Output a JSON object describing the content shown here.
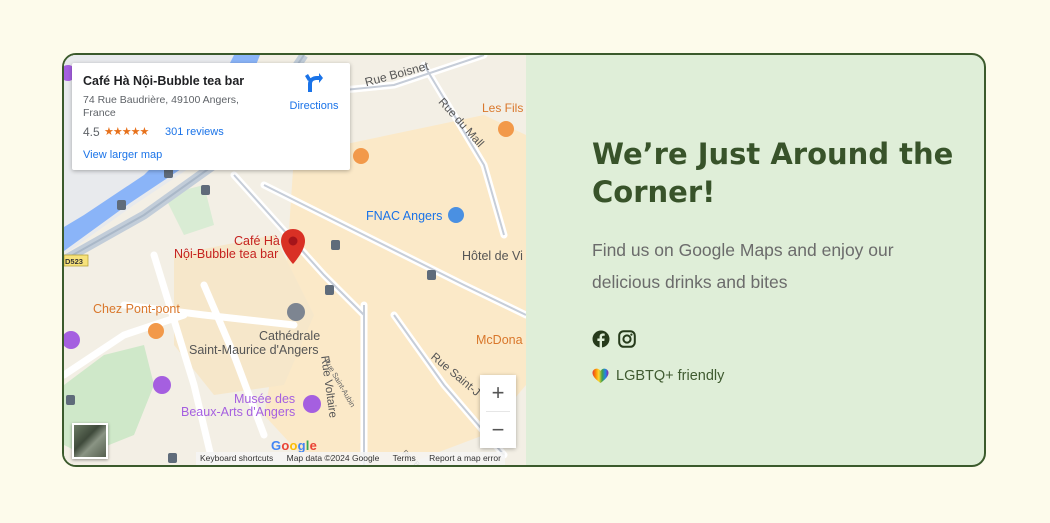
{
  "map": {
    "place_name": "Café Hà Nội-Bubble tea bar",
    "address": "74 Rue Baudrière, 49100 Angers, France",
    "rating": "4.5",
    "stars": "★★★★★",
    "reviews": "301 reviews",
    "view_larger_map": "View larger map",
    "directions_label": "Directions",
    "labels": {
      "rue_boisnet": "Rue Boisnet",
      "rue_du_mall": "Rue du Mall",
      "les_fils": "Les Fils",
      "fnac": "FNAC Angers",
      "hotel": "Hôtel de Vi",
      "cafe_line1": "Café Hà",
      "cafe_line2": "Nội-Bubble tea bar",
      "chez_pont": "Chez Pont-pont",
      "cathedral_line1": "Cathédrale",
      "cathedral_line2": "Saint-Maurice d'Angers",
      "mcdona": "McDona",
      "rue_voltaire": "Rue Voltaire",
      "rue_saint_aubin": "Rue Saint-Aubin",
      "rue_saint": "Rue Saint-J",
      "musee_line1": "Musée des",
      "musee_line2": "Beaux-Arts d'Angers",
      "d523": "D523",
      "rue_bo": "Rue Bo"
    },
    "zoom_in": "+",
    "zoom_out": "−",
    "google_logo": [
      "G",
      "o",
      "o",
      "g",
      "l",
      "e"
    ],
    "google_colors": [
      "#4285f4",
      "#ea4335",
      "#fbbc05",
      "#4285f4",
      "#34a853",
      "#ea4335"
    ],
    "attribution": {
      "keyboard": "Keyboard shortcuts",
      "data": "Map data ©2024 Google",
      "terms": "Terms",
      "report": "Report a map error"
    }
  },
  "content": {
    "heading": "We’re Just Around the Corner!",
    "paragraph": "Find us on Google Maps and enjoy our delicious drinks and bites",
    "socials": [
      "facebook-icon",
      "instagram-icon"
    ],
    "lgbtq": "LGBTQ+ friendly"
  },
  "colors": {
    "page_bg": "#fdfbeb",
    "panel_bg": "#dfeed8",
    "border": "#3b5a2c",
    "heading": "#38532a",
    "link_blue": "#1a73e8",
    "pin_red": "#d93025"
  }
}
